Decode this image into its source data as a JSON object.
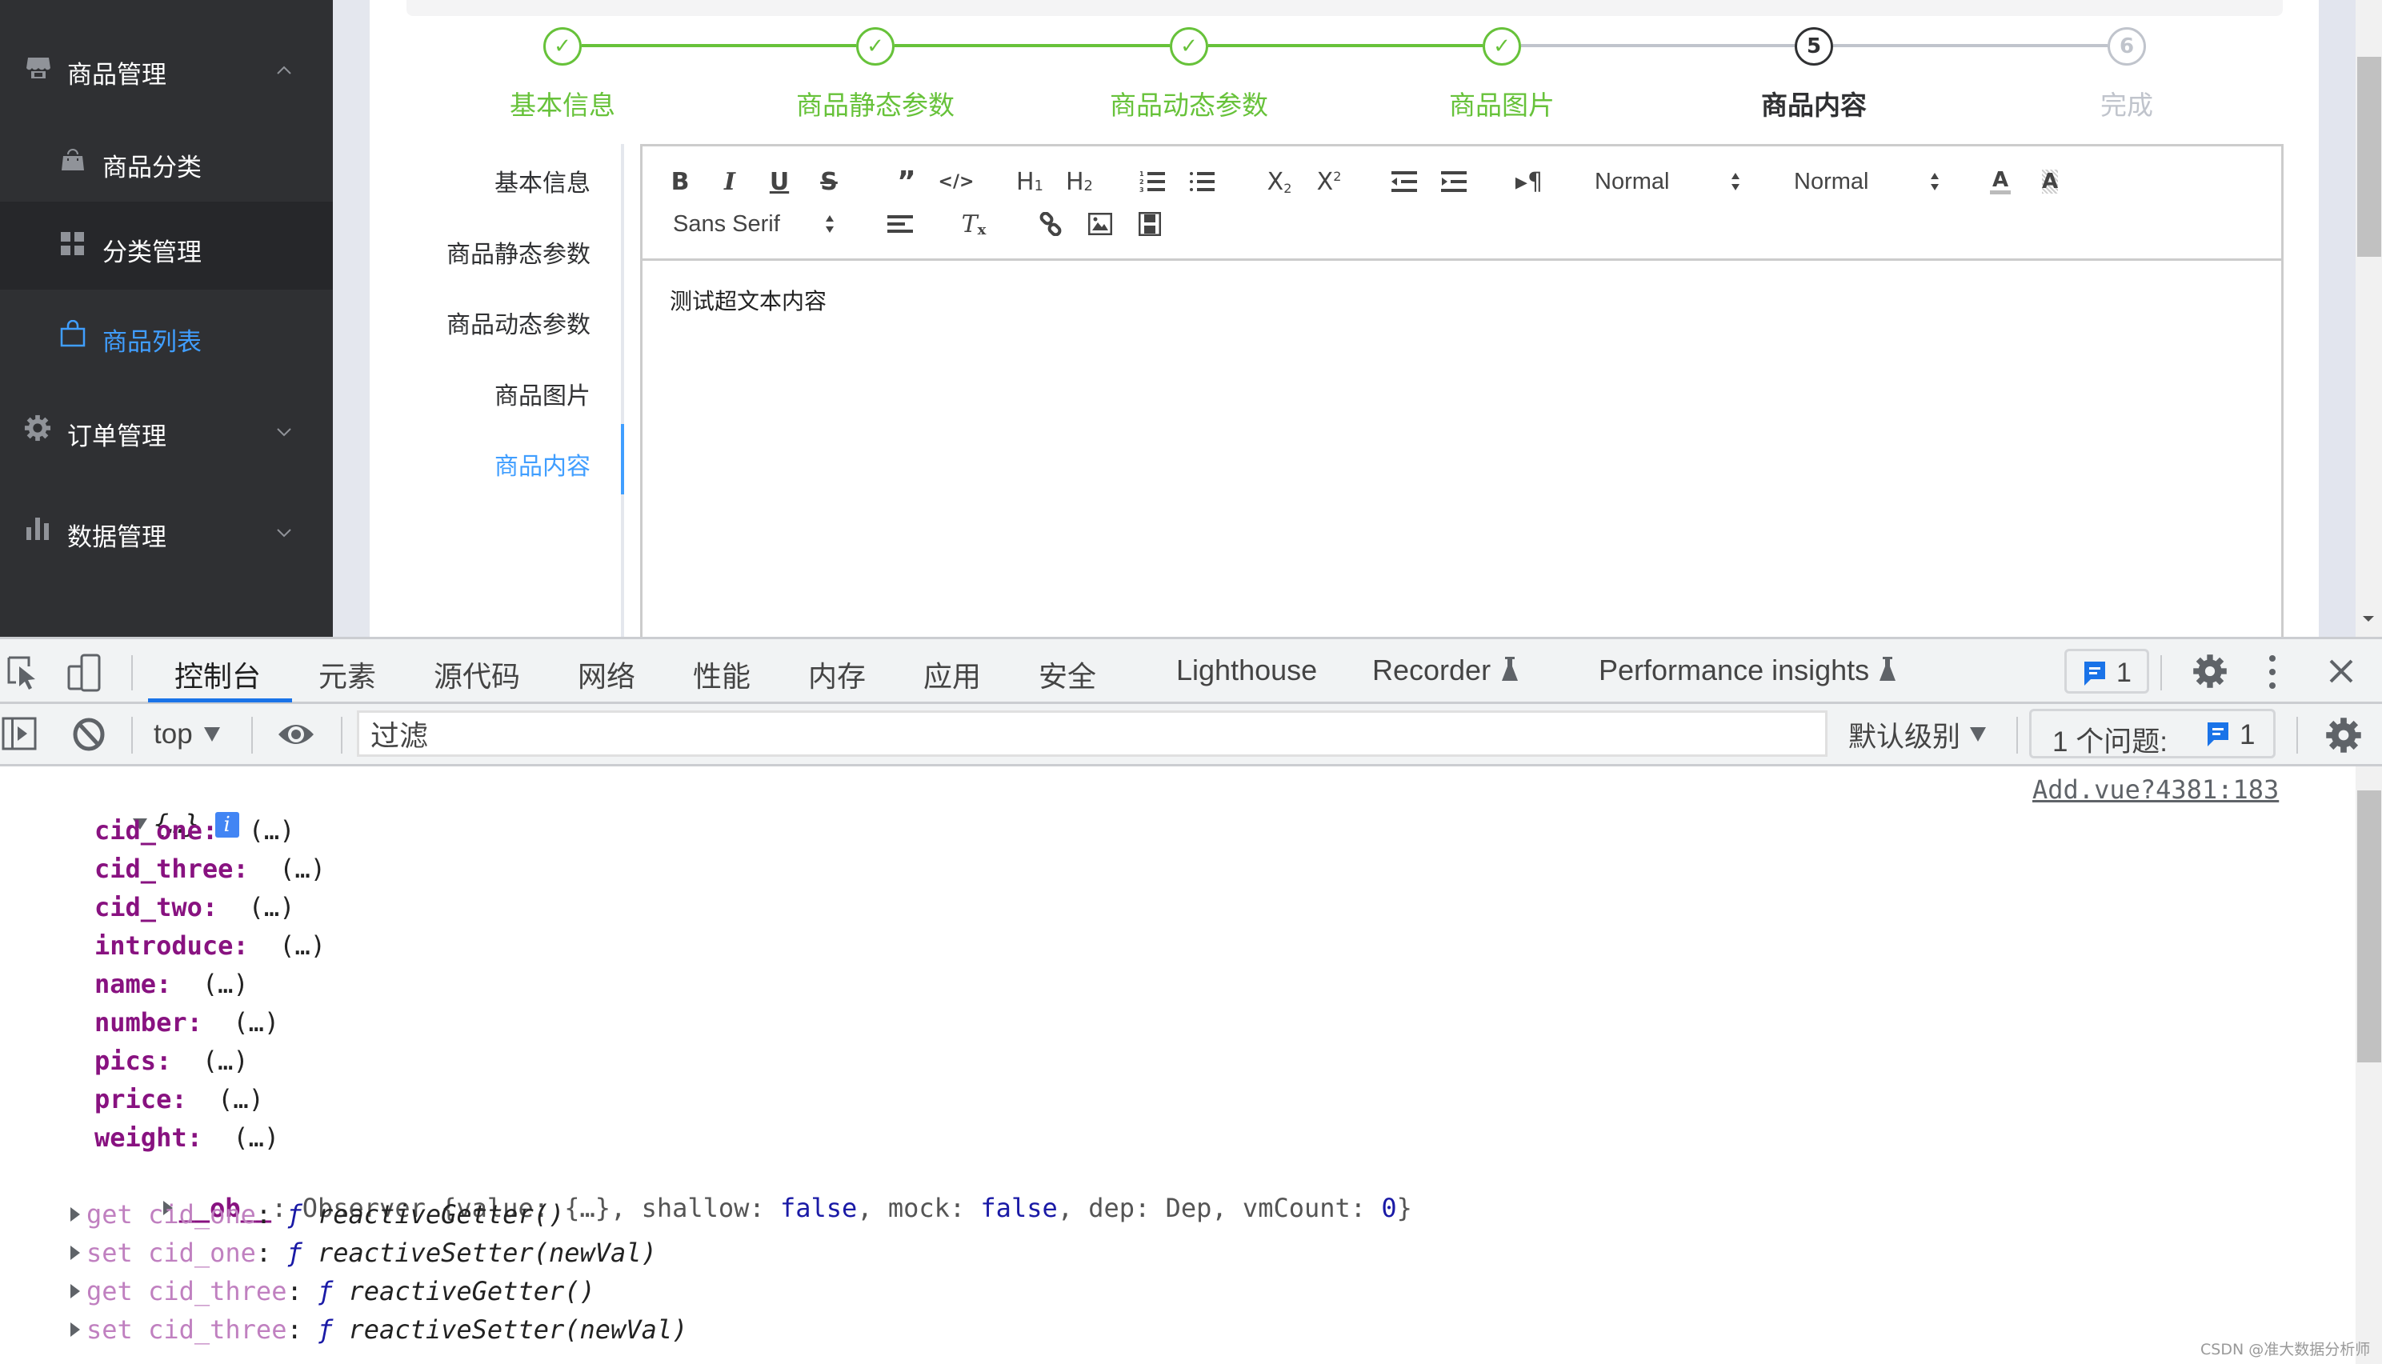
{
  "sidebar": {
    "groups": [
      {
        "label": "商品管理",
        "icon": "shop-icon",
        "expanded": true,
        "children": [
          {
            "label": "商品分类",
            "icon": "shopping-bag-icon",
            "active": false
          },
          {
            "label": "分类管理",
            "icon": "grid-icon",
            "active": false,
            "highlighted": true
          },
          {
            "label": "商品列表",
            "icon": "shopping-bag-outline-icon",
            "active": true
          }
        ]
      },
      {
        "label": "订单管理",
        "icon": "gear-icon",
        "expanded": false
      },
      {
        "label": "数据管理",
        "icon": "bar-chart-icon",
        "expanded": false
      }
    ]
  },
  "colors": {
    "success": "#67c23a",
    "active_blue": "#409eff",
    "process": "#303133",
    "wait": "#c0c4cc",
    "sidebar_bg": "#2f3033",
    "devtools_blue": "#1a73e8"
  },
  "steps": [
    {
      "index": "1",
      "label": "基本信息",
      "status": "success"
    },
    {
      "index": "2",
      "label": "商品静态参数",
      "status": "success"
    },
    {
      "index": "3",
      "label": "商品动态参数",
      "status": "success"
    },
    {
      "index": "4",
      "label": "商品图片",
      "status": "success"
    },
    {
      "index": "5",
      "label": "商品内容",
      "status": "process"
    },
    {
      "index": "6",
      "label": "完成",
      "status": "wait"
    }
  ],
  "tabs": [
    {
      "label": "基本信息",
      "active": false
    },
    {
      "label": "商品静态参数",
      "active": false
    },
    {
      "label": "商品动态参数",
      "active": false
    },
    {
      "label": "商品图片",
      "active": false
    },
    {
      "label": "商品内容",
      "active": true
    }
  ],
  "editor": {
    "toolbar": {
      "header_select": "Normal",
      "size_select": "Normal",
      "font_select": "Sans Serif"
    },
    "content": "测试超文本内容"
  },
  "devtools": {
    "tabs": [
      "控制台",
      "元素",
      "源代码",
      "网络",
      "性能",
      "内存",
      "应用",
      "安全",
      "Lighthouse",
      "Recorder",
      "Performance insights"
    ],
    "active_tab": "控制台",
    "issues_badge_count": "1",
    "filter": {
      "context": "top",
      "placeholder": "过滤",
      "level": "默认级别",
      "issues_label": "1 个问题:",
      "issues_count": "1"
    },
    "console": {
      "source_link": "Add.vue?4381:183",
      "object_summary": "{…}",
      "properties": [
        {
          "key": "cid_one",
          "value": "(…)"
        },
        {
          "key": "cid_three",
          "value": "(…)"
        },
        {
          "key": "cid_two",
          "value": "(…)"
        },
        {
          "key": "introduce",
          "value": "(…)"
        },
        {
          "key": "name",
          "value": "(…)"
        },
        {
          "key": "number",
          "value": "(…)"
        },
        {
          "key": "pics",
          "value": "(…)"
        },
        {
          "key": "price",
          "value": "(…)"
        },
        {
          "key": "weight",
          "value": "(…)"
        }
      ],
      "ob_line": {
        "key": "__ob__",
        "prefix": "Observer {value: {…}, shallow: ",
        "v1": "false",
        "mid": ", mock: ",
        "v2": "false",
        "mid2": ", dep: Dep, vmCount: ",
        "v3": "0",
        "suffix": "}"
      },
      "accessors": [
        {
          "kind": "get",
          "key": "cid_one",
          "fn": "reactiveGetter()"
        },
        {
          "kind": "set",
          "key": "cid_one",
          "fn": "reactiveSetter(newVal)"
        },
        {
          "kind": "get",
          "key": "cid_three",
          "fn": "reactiveGetter()"
        },
        {
          "kind": "set",
          "key": "cid_three",
          "fn": "reactiveSetter(newVal)"
        }
      ]
    }
  },
  "watermark": "CSDN @准大数据分析师"
}
